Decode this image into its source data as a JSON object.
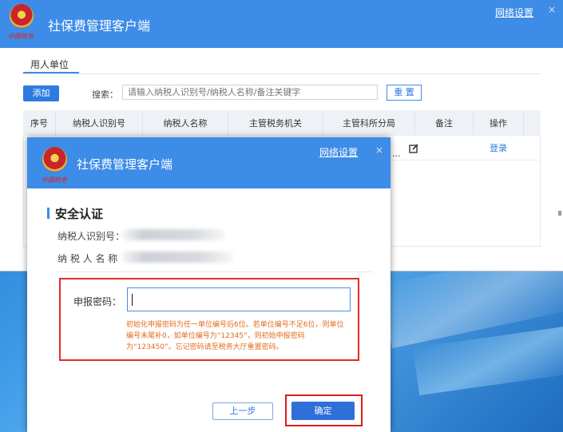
{
  "app": {
    "title": "社保费管理客户端",
    "emblem_caption": "中国税务",
    "network_settings": "网络设置",
    "close": "×"
  },
  "back_window": {
    "tab": "用人单位",
    "add_button": "添加",
    "search_label": "搜索：",
    "search_placeholder": "请输入纳税人识别号/纳税人名称/备注关键字",
    "reset_button": "重 置",
    "columns": [
      "序号",
      "纳税人识别号",
      "纳税人名称",
      "主管税务机关",
      "主管科所分局",
      "备注",
      "操作"
    ],
    "row": {
      "ellipsis": "...",
      "action": "登录"
    }
  },
  "dialog": {
    "section_title": "安全认证",
    "taxpayer_id_label": "纳税人识别号：",
    "taxpayer_name_label": "纳 税 人 名 称",
    "password_label": "申报密码：",
    "password_value": "",
    "hint": "初始化申报密码为任一单位编号后6位。若单位编号不足6位，则单位编号末尾补0，如单位编号为“12345”，则初始申报密码为“123450”。忘记密码请至税务大厅重置密码。",
    "prev_button": "上一步",
    "confirm_button": "确定"
  },
  "colors": {
    "accent": "#3d8ce8",
    "highlight": "#e52b2b",
    "hint": "#e36b1e"
  }
}
